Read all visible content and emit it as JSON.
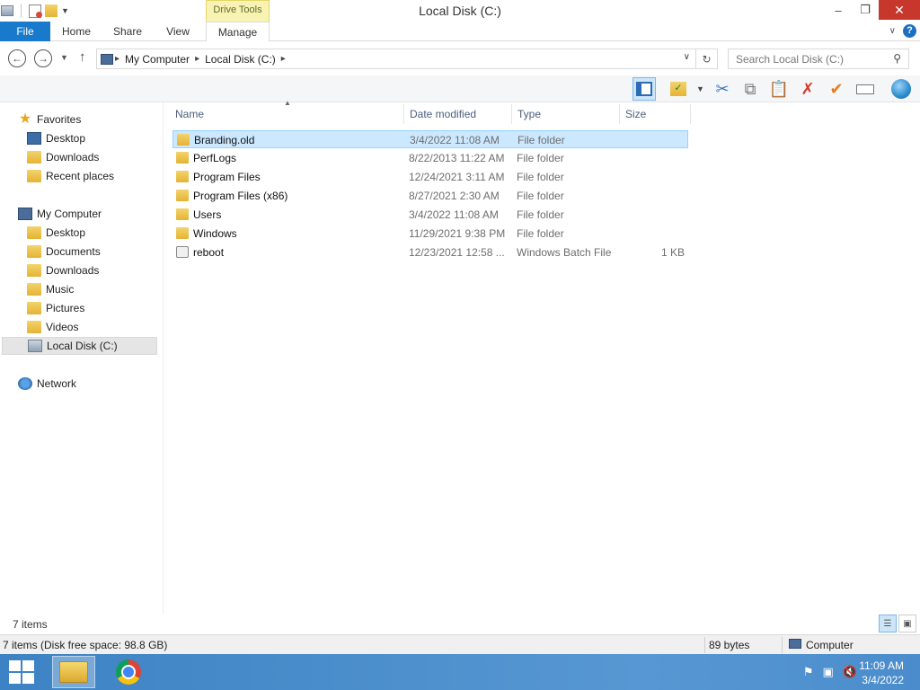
{
  "window": {
    "title": "Local Disk (C:)",
    "context_tab": "Drive Tools",
    "minimize": "–",
    "maximize": "❐",
    "close": "✕"
  },
  "ribbon": {
    "tabs": [
      {
        "label": "File"
      },
      {
        "label": "Home"
      },
      {
        "label": "Share"
      },
      {
        "label": "View"
      },
      {
        "label": "Manage"
      }
    ],
    "help": "?"
  },
  "address": {
    "crumbs": [
      "My Computer",
      "Local Disk (C:)"
    ],
    "search_placeholder": "Search Local Disk (C:)"
  },
  "nav": {
    "favorites": {
      "label": "Favorites",
      "items": [
        "Desktop",
        "Downloads",
        "Recent places"
      ]
    },
    "computer": {
      "label": "My Computer",
      "items": [
        "Desktop",
        "Documents",
        "Downloads",
        "Music",
        "Pictures",
        "Videos",
        "Local Disk (C:)"
      ]
    },
    "network": {
      "label": "Network"
    }
  },
  "columns": {
    "name": "Name",
    "date": "Date modified",
    "type": "Type",
    "size": "Size"
  },
  "files": [
    {
      "name": "Branding.old",
      "date": "3/4/2022 11:08 AM",
      "type": "File folder",
      "size": "",
      "icon": "folder-icon",
      "selected": true
    },
    {
      "name": "PerfLogs",
      "date": "8/22/2013 11:22 AM",
      "type": "File folder",
      "size": "",
      "icon": "folder-icon"
    },
    {
      "name": "Program Files",
      "date": "12/24/2021 3:11 AM",
      "type": "File folder",
      "size": "",
      "icon": "folder-icon"
    },
    {
      "name": "Program Files (x86)",
      "date": "8/27/2021 2:30 AM",
      "type": "File folder",
      "size": "",
      "icon": "folder-icon"
    },
    {
      "name": "Users",
      "date": "3/4/2022 11:08 AM",
      "type": "File folder",
      "size": "",
      "icon": "folder-icon"
    },
    {
      "name": "Windows",
      "date": "11/29/2021 9:38 PM",
      "type": "File folder",
      "size": "",
      "icon": "folder-icon"
    },
    {
      "name": "reboot",
      "date": "12/23/2021 12:58 ...",
      "type": "Windows Batch File",
      "size": "1 KB",
      "icon": "batch-file-icon"
    }
  ],
  "status": {
    "item_count": "7 items",
    "detail": "7 items (Disk free space: 98.8 GB)",
    "bytes": "89 bytes",
    "location": "Computer"
  },
  "taskbar": {
    "time": "11:09 AM",
    "date": "3/4/2022"
  },
  "colors": {
    "accent": "#1979ca",
    "selection": "#cce8ff",
    "taskbar": "#4b8ccc"
  }
}
